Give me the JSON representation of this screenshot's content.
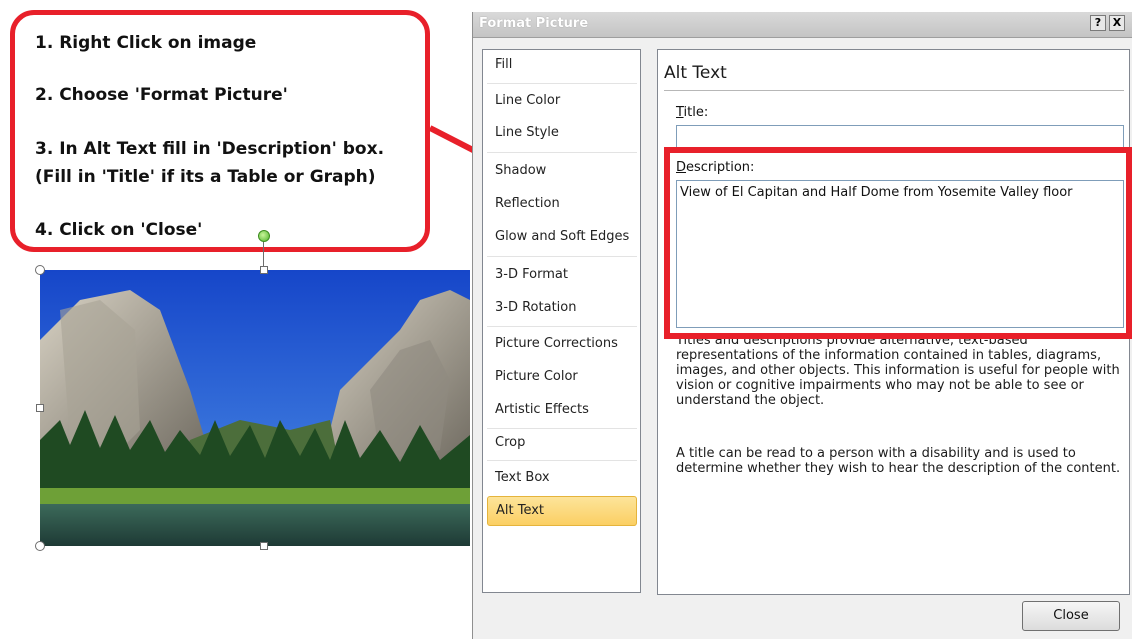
{
  "instructions": {
    "step1": "1. Right Click on image",
    "step2": "2. Choose 'Format Picture'",
    "step3_line1": "3. In Alt Text fill in 'Description' box.",
    "step3_line2": "(Fill in 'Title' if its a Table or Graph)",
    "step4": "4. Click on 'Close'"
  },
  "dialog": {
    "title": "Format Picture",
    "help_button": "?",
    "close_x": "X",
    "nav_items": [
      "Fill",
      "Line Color",
      "Line Style",
      "Shadow",
      "Reflection",
      "Glow and Soft Edges",
      "3-D Format",
      "3-D Rotation",
      "Picture Corrections",
      "Picture Color",
      "Artistic Effects",
      "Crop",
      "Text Box",
      "Alt Text"
    ],
    "selected_nav": "Alt Text",
    "panel": {
      "heading": "Alt Text",
      "title_label_prefix": "T",
      "title_label_rest": "itle:",
      "title_value": "",
      "description_label_prefix": "D",
      "description_label_rest": "escription:",
      "description_value": "View of El Capitan and Half Dome from Yosemite Valley floor",
      "help_para1": "Titles and descriptions provide alternative, text-based representations of the information contained in tables, diagrams, images, and other objects. This information is useful for people with vision or cognitive impairments who may not be able to see or understand the object.",
      "help_para2": "A title can be read to a person with a disability and is used to determine whether they wish to hear the description of the content."
    },
    "close_button": "Close"
  },
  "colors": {
    "callout_red": "#e8202a",
    "selected_nav": "#fbcf63"
  }
}
